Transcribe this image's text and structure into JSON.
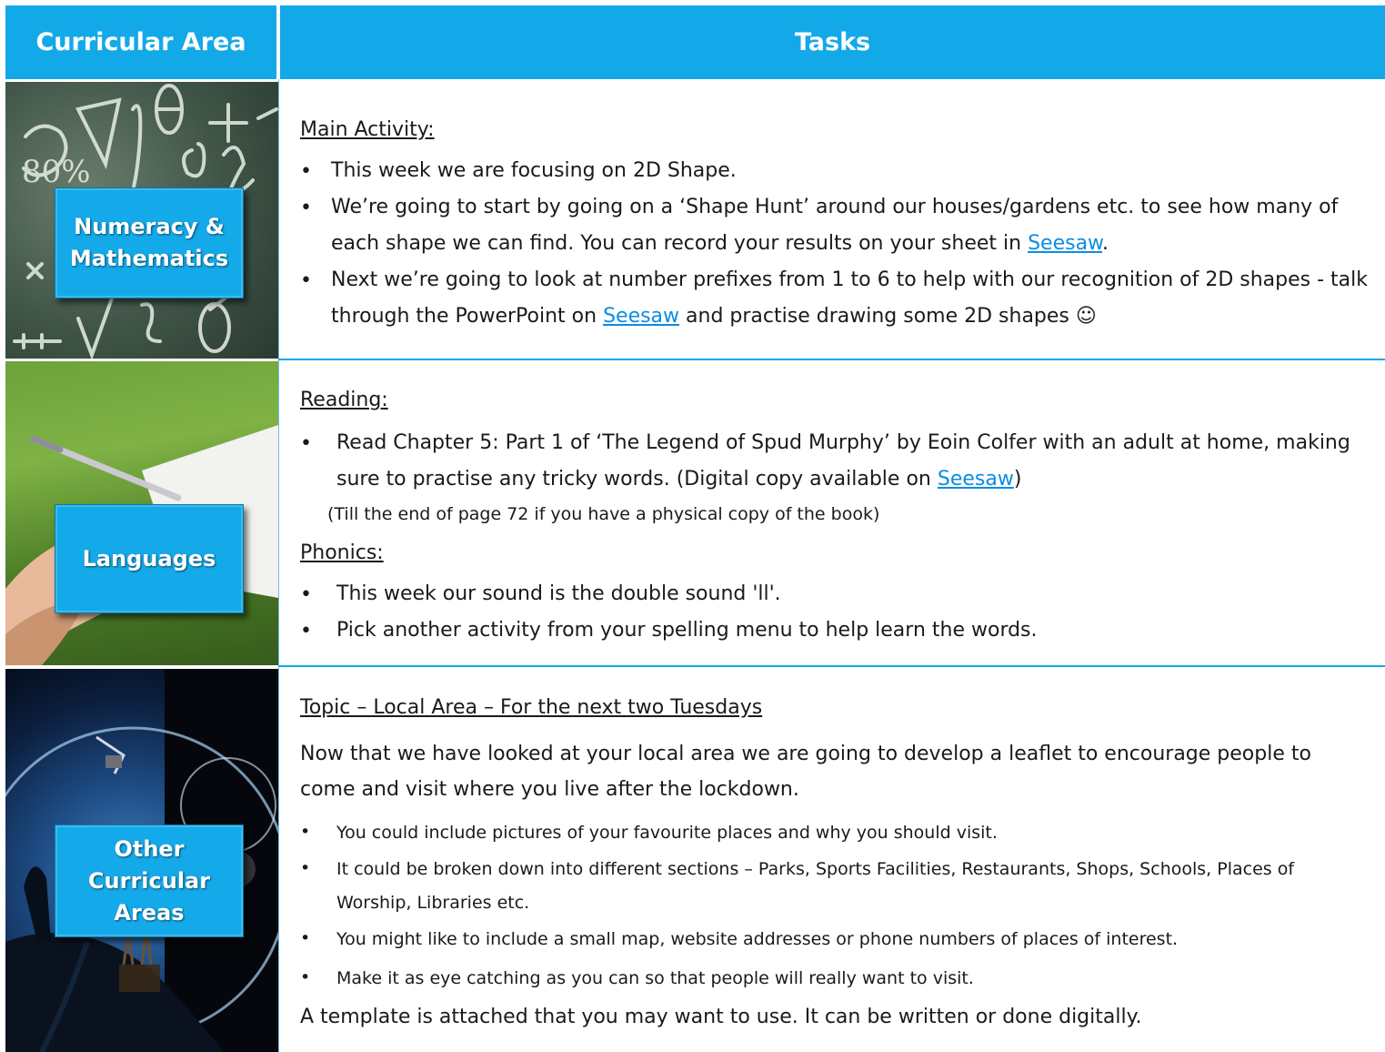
{
  "header": {
    "left_label": "Curricular Area",
    "right_label": "Tasks"
  },
  "numeracy": {
    "badge_line1": "Numeracy &",
    "badge_line2": "Mathematics",
    "heading": "Main Activity:",
    "bullet1": "This week we are focusing on 2D Shape.",
    "bullet2_text": "We’re going to start by going on a ‘Shape Hunt’ around our houses/gardens etc. to see how many of each shape we can find. You can record your results on your sheet in ",
    "bullet2_link": "Seesaw",
    "bullet2_end": ".",
    "bullet3_text": "Next we’re going to look at number prefixes from 1 to 6 to help with our recognition of 2D shapes - talk through the PowerPoint on ",
    "bullet3_link": "Seesaw",
    "bullet3_end": " and practise drawing some 2D shapes ☺"
  },
  "languages": {
    "badge": "Languages",
    "reading_heading": "Reading:",
    "reading_text": "Read Chapter 5: Part 1 of ‘The Legend of Spud Murphy’ by Eoin Colfer with an adult at home, making sure to practise any tricky words. (Digital copy available on ",
    "reading_link": "Seesaw",
    "reading_end": ")",
    "reading_note": "(Till the end of page 72 if you have a physical copy of the book)",
    "phonics_heading": "Phonics:",
    "phonics_bullet1": "This week our sound is the double sound 'll'.",
    "phonics_bullet2": "Pick another activity from your spelling menu to help learn the words."
  },
  "other": {
    "badge_line1": "Other",
    "badge_line2": "Curricular",
    "badge_line3": "Areas",
    "heading": "Topic – Local Area – For the next two Tuesdays",
    "intro": "Now that we have looked at your local area we are going to develop a leaflet to encourage people to come and visit where you live after the lockdown.",
    "bullet1": "You could include pictures of your favourite places and why you should visit.",
    "bullet2": "It could be broken down into different sections – Parks, Sports Facilities, Restaurants, Shops, Schools, Places of Worship, Libraries etc.",
    "bullet3": "You might like to include a small map, website addresses or phone numbers of places of interest.",
    "bullet4": "Make it as eye catching as you can so that people will really want to visit.",
    "closing": "A template is attached that you may want to use. It can be written or done digitally."
  },
  "bullet_symbol": "•",
  "colors": {
    "header_bg": "#13a9e8",
    "badge_bg": "#14aaea",
    "link": "#0c8de0"
  },
  "icons": [
    "chalkboard-maths-image",
    "writing-hand-image",
    "space-bubble-image"
  ]
}
